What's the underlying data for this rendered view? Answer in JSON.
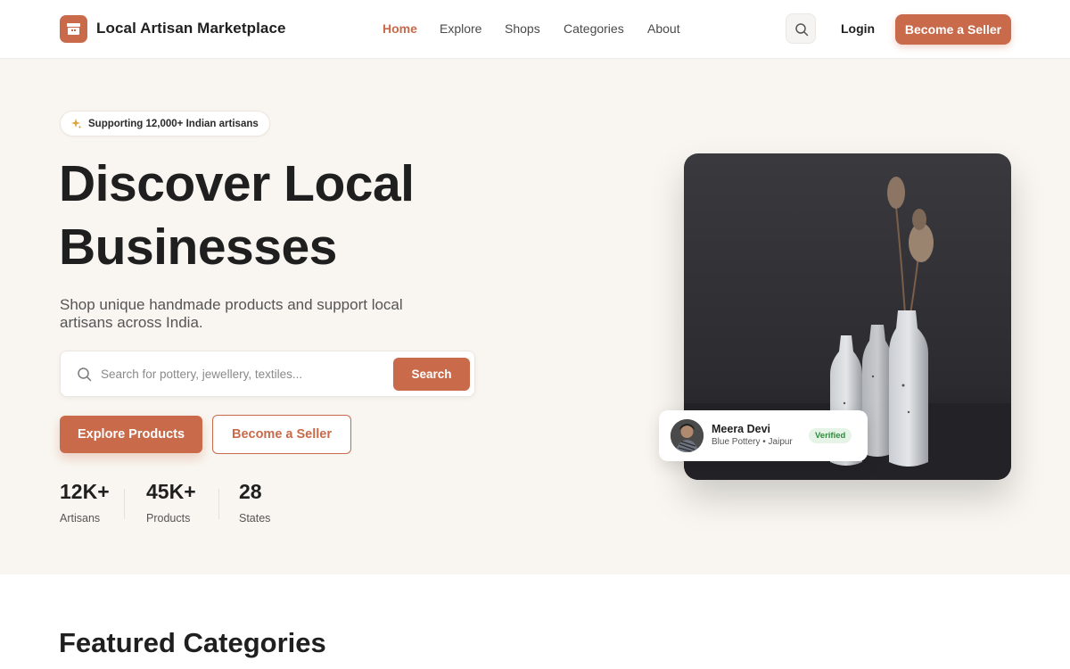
{
  "header": {
    "brand": "Local Artisan Marketplace",
    "nav": [
      "Home",
      "Explore",
      "Shops",
      "Categories",
      "About"
    ],
    "active_nav": "Home",
    "login_label": "Login",
    "seller_label": "Become a Seller"
  },
  "hero": {
    "badge": "Supporting 12,000+ Indian artisans",
    "title_line1": "Discover Local",
    "title_line2": "Businesses",
    "subtitle": "Shop unique handmade products and support local artisans across India.",
    "search_placeholder": "Search for pottery, jewellery, textiles...",
    "search_button": "Search",
    "explore_button": "Explore Products",
    "seller_button": "Become a Seller",
    "stats": [
      {
        "value": "12K+",
        "label": "Artisans"
      },
      {
        "value": "45K+",
        "label": "Products"
      },
      {
        "value": "28",
        "label": "States"
      }
    ],
    "seller_card": {
      "name": "Meera Devi",
      "meta": "Blue Pottery • Jaipur",
      "badge": "Verified"
    }
  },
  "featured": {
    "title": "Featured Categories"
  },
  "colors": {
    "accent": "#c96a4b",
    "hero_bg": "#f9f6f1",
    "verified": "#2f8a3d"
  }
}
